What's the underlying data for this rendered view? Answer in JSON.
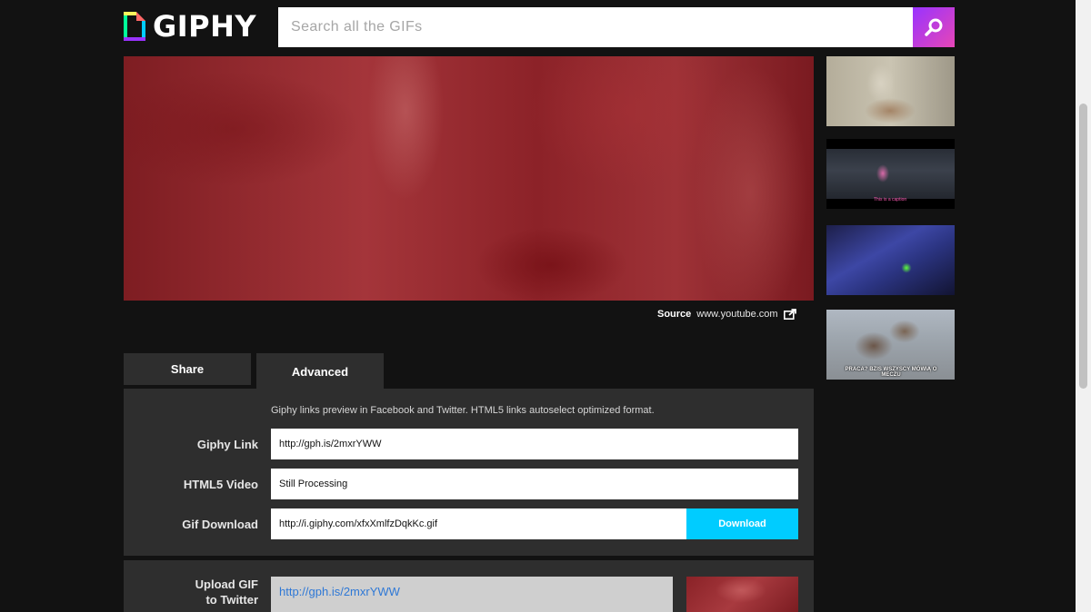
{
  "header": {
    "logo_text": "GIPHY",
    "search_placeholder": "Search all the GIFs"
  },
  "media": {
    "source_label": "Source",
    "source_value": "www.youtube.com"
  },
  "tabs": [
    {
      "label": "Share"
    },
    {
      "label": "Advanced"
    }
  ],
  "advanced": {
    "note": "Giphy links preview in Facebook and Twitter. HTML5 links autoselect optimized format.",
    "rows": [
      {
        "label": "Giphy Link",
        "value": "http://gph.is/2mxrYWW"
      },
      {
        "label": "HTML5 Video",
        "value": "Still Processing"
      },
      {
        "label": "Gif Download",
        "value": "http://i.giphy.com/xfxXmlfzDqkKc.gif"
      }
    ],
    "download_label": "Download"
  },
  "upload": {
    "label_line1": "Upload GIF",
    "label_line2": "to Twitter",
    "value": "http://gph.is/2mxrYWW"
  },
  "sidebar": {
    "thumbs": [
      {
        "caption": ""
      },
      {
        "caption": "This is a caption"
      },
      {
        "caption": ""
      },
      {
        "caption": "PRACA? BZIS WSZYSCY MÓWIĄ O MECZU"
      }
    ]
  },
  "colors": {
    "background": "#121212",
    "panel": "#2e2e2e",
    "accent_blue": "#00ccff",
    "search_gradient_start": "#9933ff",
    "search_gradient_end": "#e646b6",
    "link_blue": "#2e78d6"
  }
}
